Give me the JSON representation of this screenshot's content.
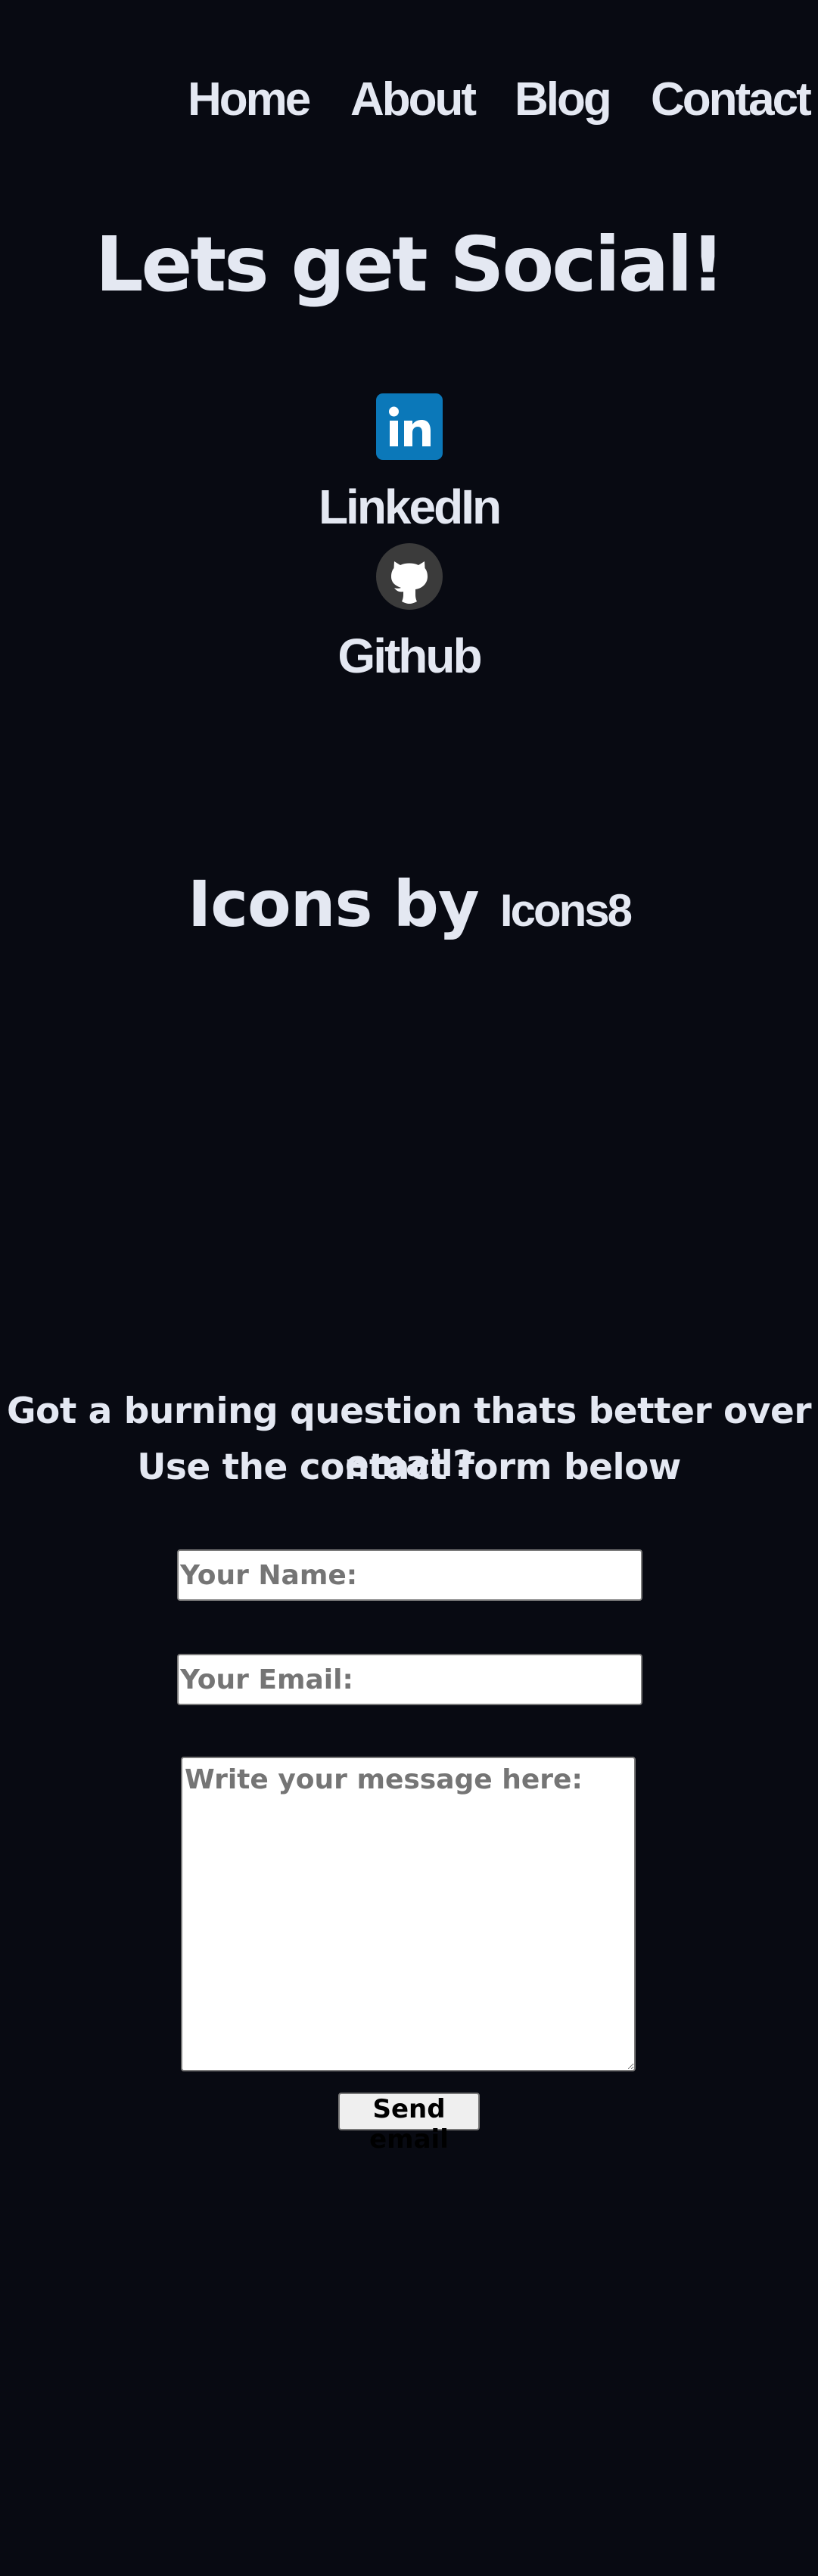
{
  "nav": {
    "items": [
      {
        "label": "Home"
      },
      {
        "label": "About"
      },
      {
        "label": "Blog"
      },
      {
        "label": "Contact"
      }
    ]
  },
  "hero": {
    "title": "Lets get Social!"
  },
  "social": {
    "linkedin": {
      "label": "LinkedIn",
      "icon": "linkedin-icon",
      "color": "#0b78b9"
    },
    "github": {
      "label": "Github",
      "icon": "github-icon",
      "color": "#3b3b3b"
    }
  },
  "credit": {
    "prefix": "Icons by",
    "link": "Icons8"
  },
  "contact": {
    "line1": "Got a burning question thats better over email?",
    "line2": "Use the contact form below",
    "name_placeholder": "Your Name:",
    "email_placeholder": "Your Email:",
    "message_placeholder": "Write your message here:",
    "send_label": "Send email"
  },
  "colors": {
    "background": "#080a12",
    "text": "#e4e8f2"
  }
}
